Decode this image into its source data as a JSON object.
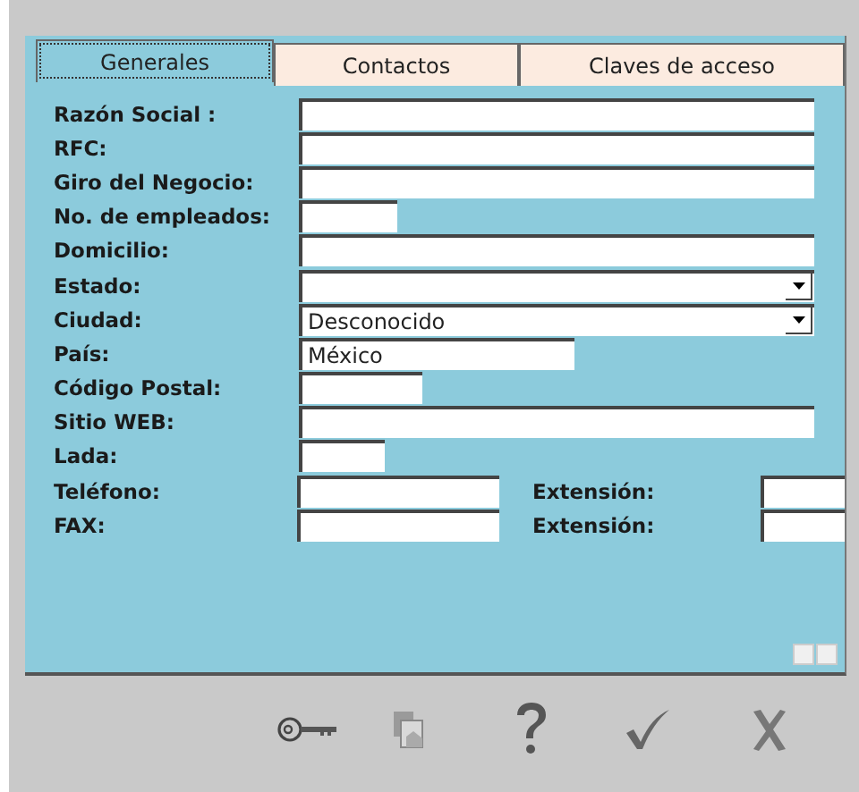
{
  "tabs": [
    {
      "label": "Generales",
      "selected": true
    },
    {
      "label": "Contactos",
      "selected": false
    },
    {
      "label": "Claves de acceso",
      "selected": false
    }
  ],
  "rows": [
    {
      "label": "Razón Social :",
      "field": {
        "kind": "text"
      }
    },
    {
      "label": "RFC:",
      "field": {
        "kind": "text"
      }
    },
    {
      "label": "Giro del Negocio:",
      "field": {
        "kind": "text"
      }
    },
    {
      "label": "No. de empleados:",
      "field": {
        "kind": "text"
      }
    },
    {
      "label": "Domicilio:",
      "field": {
        "kind": "text"
      }
    },
    {
      "label": "Estado:",
      "field": {
        "kind": "select"
      }
    },
    {
      "label": "Ciudad:",
      "field": {
        "kind": "select",
        "value": "Desconocido"
      }
    },
    {
      "label": "País:",
      "field": {
        "kind": "text",
        "value": "México"
      }
    },
    {
      "label": "Código Postal:",
      "field": {
        "kind": "text"
      }
    },
    {
      "label": "Sitio WEB:",
      "field": {
        "kind": "text"
      }
    },
    {
      "label": "Lada:",
      "field": {
        "kind": "text"
      }
    },
    {
      "label": "Teléfono:",
      "field": {
        "kind": "text"
      },
      "extension": {
        "label": "Extensión:"
      }
    },
    {
      "label": "FAX:",
      "field": {
        "kind": "text"
      },
      "extension": {
        "label": "Extensión:"
      }
    }
  ]
}
